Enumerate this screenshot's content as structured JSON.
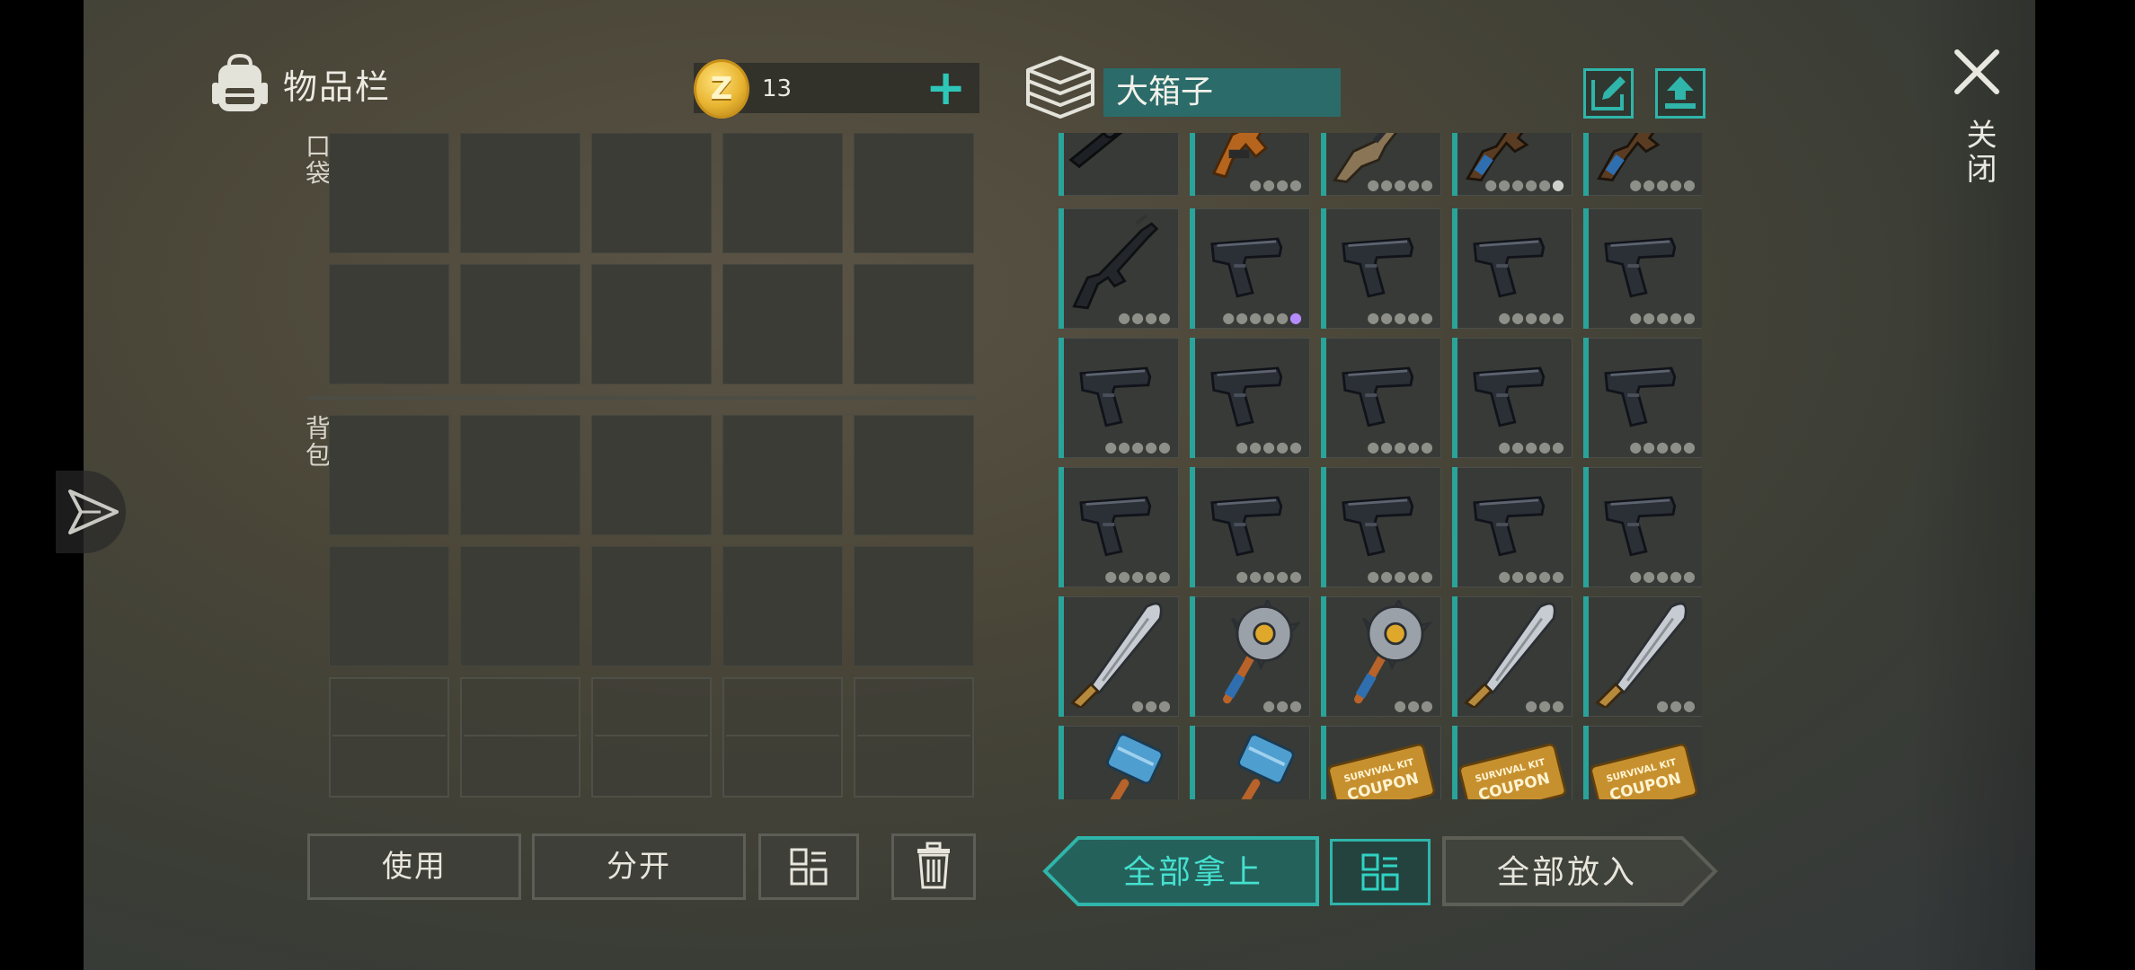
{
  "inventory": {
    "title": "物品栏",
    "section_pocket": "口袋",
    "section_backpack": "背包",
    "coin_icon_letter": "Z",
    "coin_count": "13",
    "add_label": "+"
  },
  "storage": {
    "name": "大箱子"
  },
  "close": {
    "label": "关闭"
  },
  "actions": {
    "use": "使用",
    "split": "分开",
    "take_all": "全部拿上",
    "put_all": "全部放入"
  },
  "storage_items": [
    [
      "scoped-rifle",
      "hunting-rifle",
      "shotgun",
      "ak-rifle-blue",
      "ak-rifle-blue"
    ],
    [
      "m16-rifle",
      "pistol",
      "pistol",
      "pistol",
      "pistol"
    ],
    [
      "pistol",
      "pistol",
      "pistol",
      "pistol",
      "pistol"
    ],
    [
      "pistol",
      "pistol",
      "pistol",
      "pistol",
      "pistol"
    ],
    [
      "machete",
      "sawblade-mace",
      "sawblade-mace",
      "machete",
      "machete"
    ],
    [
      "sledgehammer",
      "sledgehammer",
      "survival-kit-coupon",
      "survival-kit-coupon",
      "survival-kit-coupon"
    ]
  ],
  "coupon_text": [
    "SURVIVAL KIT",
    "COUPON"
  ],
  "colors": {
    "accent": "#2fb5aa",
    "box_label_bg": "#2b6b6a",
    "coin": "#e8b431",
    "rarity_purple": "#b58cff"
  }
}
